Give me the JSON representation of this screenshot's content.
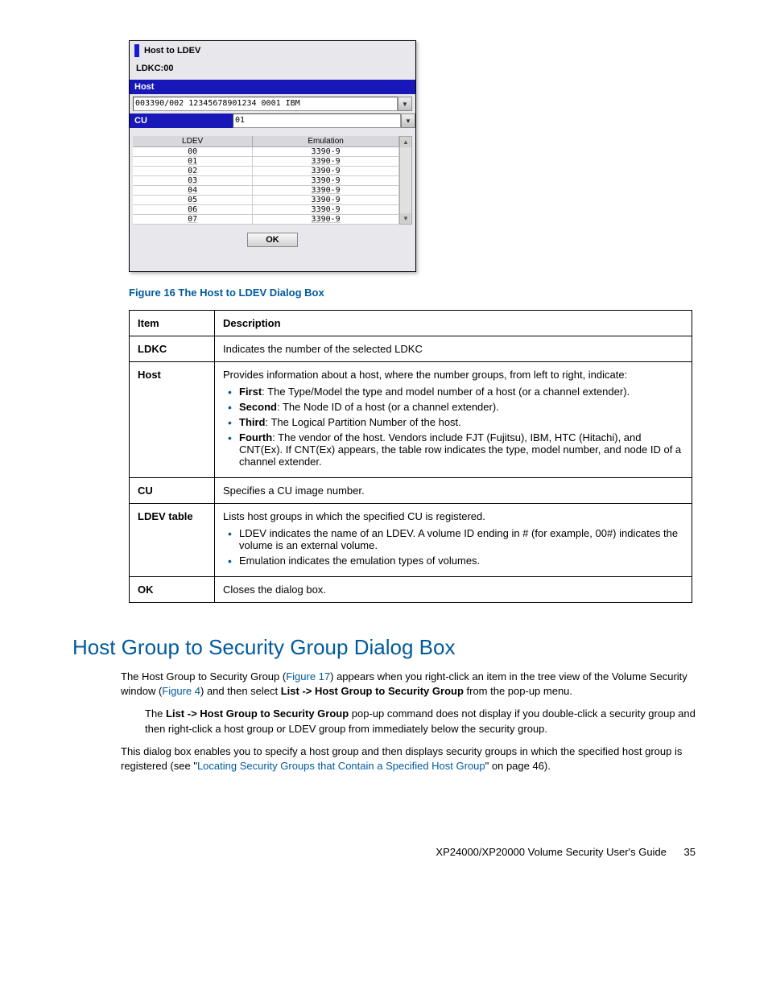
{
  "dialog": {
    "title": "Host to LDEV",
    "ldkc_label": "LDKC:00",
    "host_header": "Host",
    "host_value": "003390/002 12345678901234 0001 IBM",
    "cu_header": "CU",
    "cu_value": "01",
    "table": {
      "col1": "LDEV",
      "col2": "Emulation",
      "rows": [
        {
          "ldev": "00",
          "emu": "3390-9"
        },
        {
          "ldev": "01",
          "emu": "3390-9"
        },
        {
          "ldev": "02",
          "emu": "3390-9"
        },
        {
          "ldev": "03",
          "emu": "3390-9"
        },
        {
          "ldev": "04",
          "emu": "3390-9"
        },
        {
          "ldev": "05",
          "emu": "3390-9"
        },
        {
          "ldev": "06",
          "emu": "3390-9"
        },
        {
          "ldev": "07",
          "emu": "3390-9"
        }
      ]
    },
    "ok_label": "OK"
  },
  "figure_caption": "Figure 16 The Host to LDEV Dialog Box",
  "desc_table": {
    "h1": "Item",
    "h2": "Description",
    "rows": {
      "ldkc": {
        "item": "LDKC",
        "desc": "Indicates the number of the selected LDKC"
      },
      "host": {
        "item": "Host",
        "lead": "Provides information about a host, where the number groups, from left to right, indicate:",
        "b1_label": "First",
        "b1_text": ": The Type/Model the type and model number of a host (or a channel extender).",
        "b2_label": "Second",
        "b2_text": ": The Node ID of a host (or a channel extender).",
        "b3_label": "Third",
        "b3_text": ": The Logical Partition Number of the host.",
        "b4_label": "Fourth",
        "b4_text": ": The vendor of the host. Vendors include FJT (Fujitsu), IBM, HTC (Hitachi), and CNT(Ex). If CNT(Ex) appears, the table row indicates the type, model number, and node ID of a channel extender."
      },
      "cu": {
        "item": "CU",
        "desc": "Specifies a CU image number."
      },
      "ldev": {
        "item": "LDEV table",
        "lead": "Lists host groups in which the specified CU is registered.",
        "b1": "LDEV indicates the name of an LDEV. A volume ID ending in # (for example, 00#) indicates the volume is an external volume.",
        "b2": "Emulation indicates the emulation types of volumes."
      },
      "ok": {
        "item": "OK",
        "desc": "Closes the dialog box."
      }
    }
  },
  "section": {
    "heading": "Host Group to Security Group Dialog Box",
    "p1a": "The Host Group to Security Group (",
    "p1_link1": "Figure 17",
    "p1b": ") appears when you right-click an item in the tree view of the Volume Security window (",
    "p1_link2": "Figure 4",
    "p1c": ") and then select ",
    "p1_bold": "List -> Host Group to Security Group",
    "p1d": " from the pop-up menu.",
    "p2a": "The ",
    "p2_bold": "List -> Host Group to Security Group",
    "p2b": " pop-up command does not display if you double-click a security group and then right-click a host group or LDEV group from immediately below the security group.",
    "p3a": "This dialog box enables you to specify a host group and then displays security groups in which the specified host group is registered (see \"",
    "p3_link": "Locating Security Groups that Contain a Specified Host Group",
    "p3b": "\" on page 46)."
  },
  "footer": {
    "title": "XP24000/XP20000 Volume Security User's Guide",
    "page": "35"
  }
}
